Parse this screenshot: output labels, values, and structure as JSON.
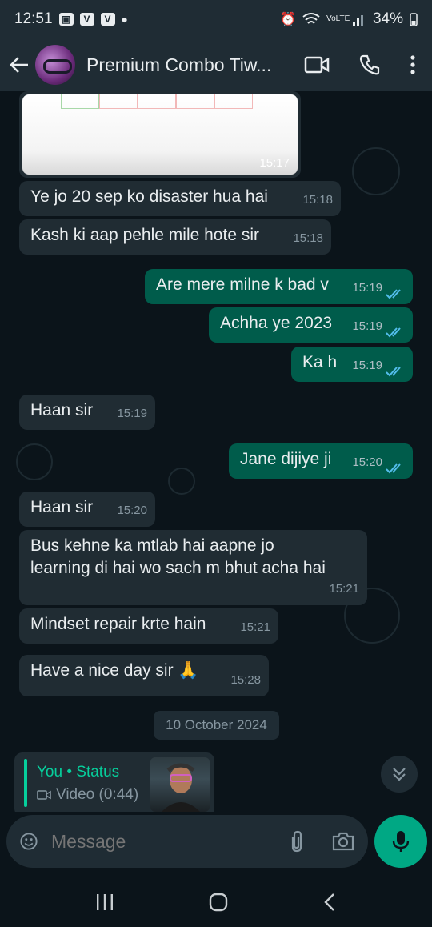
{
  "status_bar": {
    "time": "12:51",
    "battery": "34%",
    "network": "VoLTE"
  },
  "header": {
    "contact_name": "Premium Combo Tiw..."
  },
  "messages": [
    {
      "dir": "in",
      "text": "Ye jo 20 sep ko disaster hua hai",
      "time": "15:18"
    },
    {
      "dir": "in",
      "text": "Kash ki aap pehle mile hote sir",
      "time": "15:18"
    },
    {
      "dir": "out",
      "text": "Are mere milne k bad v",
      "time": "15:19"
    },
    {
      "dir": "out",
      "text": "Achha ye 2023",
      "time": "15:19"
    },
    {
      "dir": "out",
      "text": "Ka h",
      "time": "15:19"
    },
    {
      "dir": "in",
      "text": "Haan sir",
      "time": "15:19"
    },
    {
      "dir": "out",
      "text": "Jane dijiye ji",
      "time": "15:20"
    },
    {
      "dir": "in",
      "text": "Haan sir",
      "time": "15:20"
    },
    {
      "dir": "in",
      "text_line1": "Bus kehne ka mtlab hai aapne jo",
      "text_line2": "learning di hai wo sach m bhut acha hai",
      "time": "15:21"
    },
    {
      "dir": "in",
      "text": "Mindset repair krte hain",
      "time": "15:21"
    },
    {
      "dir": "in",
      "text": "Have a nice day sir 🙏",
      "time": "15:28"
    }
  ],
  "image_message": {
    "time": "15:17"
  },
  "date_divider": "10 October 2024",
  "reply_preview": {
    "author": "You • Status",
    "media": "Video (0:44)"
  },
  "composer": {
    "placeholder": "Message"
  },
  "colors": {
    "accent": "#00a884",
    "out_bubble": "#005c4b",
    "in_bubble": "#202c33",
    "read_ticks": "#53bdeb"
  }
}
